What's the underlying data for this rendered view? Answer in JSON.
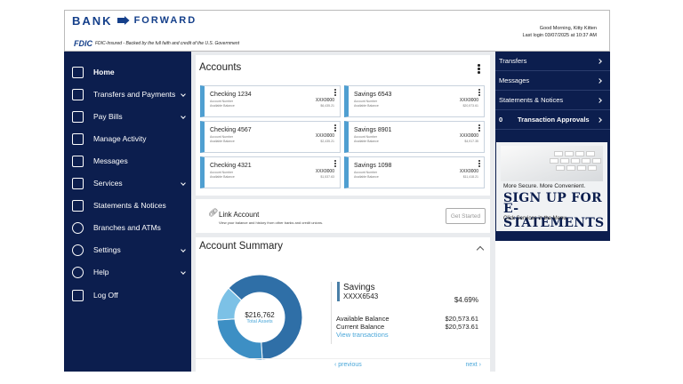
{
  "brand": {
    "bank": "BANK",
    "forward": "FORWARD",
    "fdic_mark": "FDIC",
    "fdic_text": "FDIC-Insured - Backed by the full faith and credit of the U.S. Government"
  },
  "greeting": {
    "line1": "Good Morning, Kitty Kitten",
    "line2": "Last login 03/07/2025 at 10:37 AM"
  },
  "sidebar": {
    "items": [
      {
        "label": "Home",
        "icon": "home-icon",
        "chevron": false
      },
      {
        "label": "Transfers and Payments",
        "icon": "transfer-icon",
        "chevron": true
      },
      {
        "label": "Pay Bills",
        "icon": "bill-icon",
        "chevron": true
      },
      {
        "label": "Manage Activity",
        "icon": "chart-icon",
        "chevron": false
      },
      {
        "label": "Messages",
        "icon": "mail-icon",
        "chevron": false
      },
      {
        "label": "Services",
        "icon": "phone-icon",
        "chevron": true
      },
      {
        "label": "Statements & Notices",
        "icon": "statement-icon",
        "chevron": false
      },
      {
        "label": "Branches and ATMs",
        "icon": "location-icon",
        "chevron": false
      },
      {
        "label": "Settings",
        "icon": "gear-icon",
        "chevron": true
      },
      {
        "label": "Help",
        "icon": "help-icon",
        "chevron": true
      },
      {
        "label": "Log Off",
        "icon": "logout-icon",
        "chevron": false
      }
    ]
  },
  "accounts": {
    "title": "Accounts",
    "cards": [
      {
        "name": "Checking 1234",
        "sub1": "Account Number",
        "sub2": "Available Balance",
        "mask": "XXX0000",
        "amount": "$6,435.21"
      },
      {
        "name": "Savings 6543",
        "sub1": "Account Number",
        "sub2": "Available Balance",
        "mask": "XXX0000",
        "amount": "$20,573.61"
      },
      {
        "name": "Checking 4567",
        "sub1": "Account Number",
        "sub2": "Available Balance",
        "mask": "XXX0000",
        "amount": "$2,435.21"
      },
      {
        "name": "Savings 8901",
        "sub1": "Account Number",
        "sub2": "Available Balance",
        "mask": "XXX0000",
        "amount": "$4,917.35"
      },
      {
        "name": "Checking 4321",
        "sub1": "Account Number",
        "sub2": "Available Balance",
        "mask": "XXX0000",
        "amount": "$1,537.63"
      },
      {
        "name": "Savings 1098",
        "sub1": "Account Number",
        "sub2": "Available Balance",
        "mask": "XXX0000",
        "amount": "$11,418.21"
      }
    ]
  },
  "link": {
    "title": "Link Account",
    "desc": "View your balance and history from other banks and credit unions.",
    "button": "Get Started"
  },
  "summary": {
    "title": "Account Summary",
    "total": "$216,762",
    "total_label": "Total Assets",
    "name": "Savings",
    "number": "XXXX6543",
    "rate": "$4.69%",
    "available_label": "Available Balance",
    "available_value": "$20,573.61",
    "current_label": "Current Balance",
    "current_value": "$20,573.61",
    "view": "View transactions",
    "prev": "previous",
    "next": "next",
    "chart_data": {
      "type": "pie",
      "categories": [
        "Segment 1",
        "Segment 2",
        "Segment 3"
      ],
      "values": [
        62,
        25,
        13
      ],
      "colors": [
        "#2f6fa7",
        "#3d8fc4",
        "#7cc1e6"
      ]
    }
  },
  "right": {
    "items": [
      {
        "label": "Transfers"
      },
      {
        "label": "Messages"
      },
      {
        "label": "Statements & Notices"
      }
    ],
    "approvals": {
      "count": "0",
      "label": "Transaction Approvals"
    },
    "promo": {
      "l1": "More Secure. More Convenient.",
      "l2": "SIGN UP FOR",
      "l3": "E-STATEMENTS",
      "l4": "Click Services in the Menu"
    }
  }
}
